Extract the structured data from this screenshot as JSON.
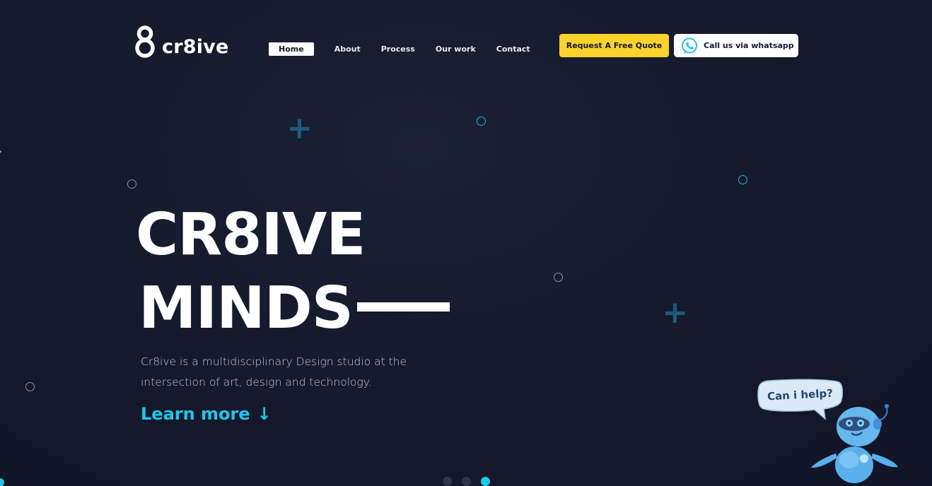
{
  "brand": {
    "logo_mark": "8",
    "logo_text": "cr8ive"
  },
  "nav": {
    "items": [
      {
        "label": "Home",
        "active": true
      },
      {
        "label": "About",
        "active": false
      },
      {
        "label": "Process",
        "active": false
      },
      {
        "label": "Our work",
        "active": false
      },
      {
        "label": "Contact",
        "active": false
      }
    ]
  },
  "actions": {
    "quote_label": "Request A Free Quote",
    "whatsapp_label": "Call us via whatsapp",
    "whatsapp_icon": "whatsapp-icon"
  },
  "hero": {
    "line1": "CR8IVE",
    "line2": "MINDS",
    "description_line1": "Cr8ive is a multidisciplinary Design studio at the",
    "description_line2": "intersection of art, design and technology.",
    "learn_more": "Learn more",
    "learn_more_arrow": "↓"
  },
  "chat": {
    "bubble": "Can i help?",
    "icon": "robot-assistant-icon"
  },
  "slider": {
    "slides": 3,
    "active_index": 2
  },
  "colors": {
    "background": "#161a2d",
    "accent_cyan": "#1ec6ec",
    "quote_yellow": "#fcd22c",
    "decor_blue": "#1d5a7e"
  }
}
